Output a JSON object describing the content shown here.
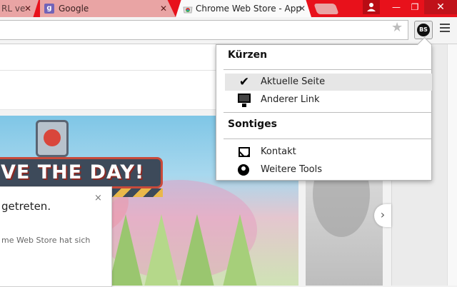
{
  "tabs": [
    {
      "label": "RL ve",
      "close": "✕"
    },
    {
      "label": "Google",
      "close": "✕",
      "favicon": "g"
    },
    {
      "label": "Chrome Web Store - App",
      "close": "✕"
    }
  ],
  "window": {
    "close": "✕",
    "min": "—",
    "max": "❐"
  },
  "toolbar": {
    "omnibox_value": "",
    "extension_badge": "BS"
  },
  "menu": {
    "section1_title": "Kürzen",
    "section1_items": [
      {
        "label": "Aktuelle Seite",
        "icon": "checkmark-icon",
        "active": true
      },
      {
        "label": "Anderer Link",
        "icon": "monitor-icon"
      }
    ],
    "section2_title": "Sontiges",
    "section2_items": [
      {
        "label": "Kontakt",
        "icon": "envelope-icon"
      },
      {
        "label": "Weitere Tools",
        "icon": "globe-icon"
      }
    ]
  },
  "banner": {
    "text": "VE THE DAY!"
  },
  "notification": {
    "title": "getreten.",
    "body": "me Web Store hat sich",
    "close": "×"
  },
  "carousel": {
    "next": "›"
  },
  "colors": {
    "tabstrip": "#e8111b",
    "menu_active": "#e6e6e6"
  }
}
